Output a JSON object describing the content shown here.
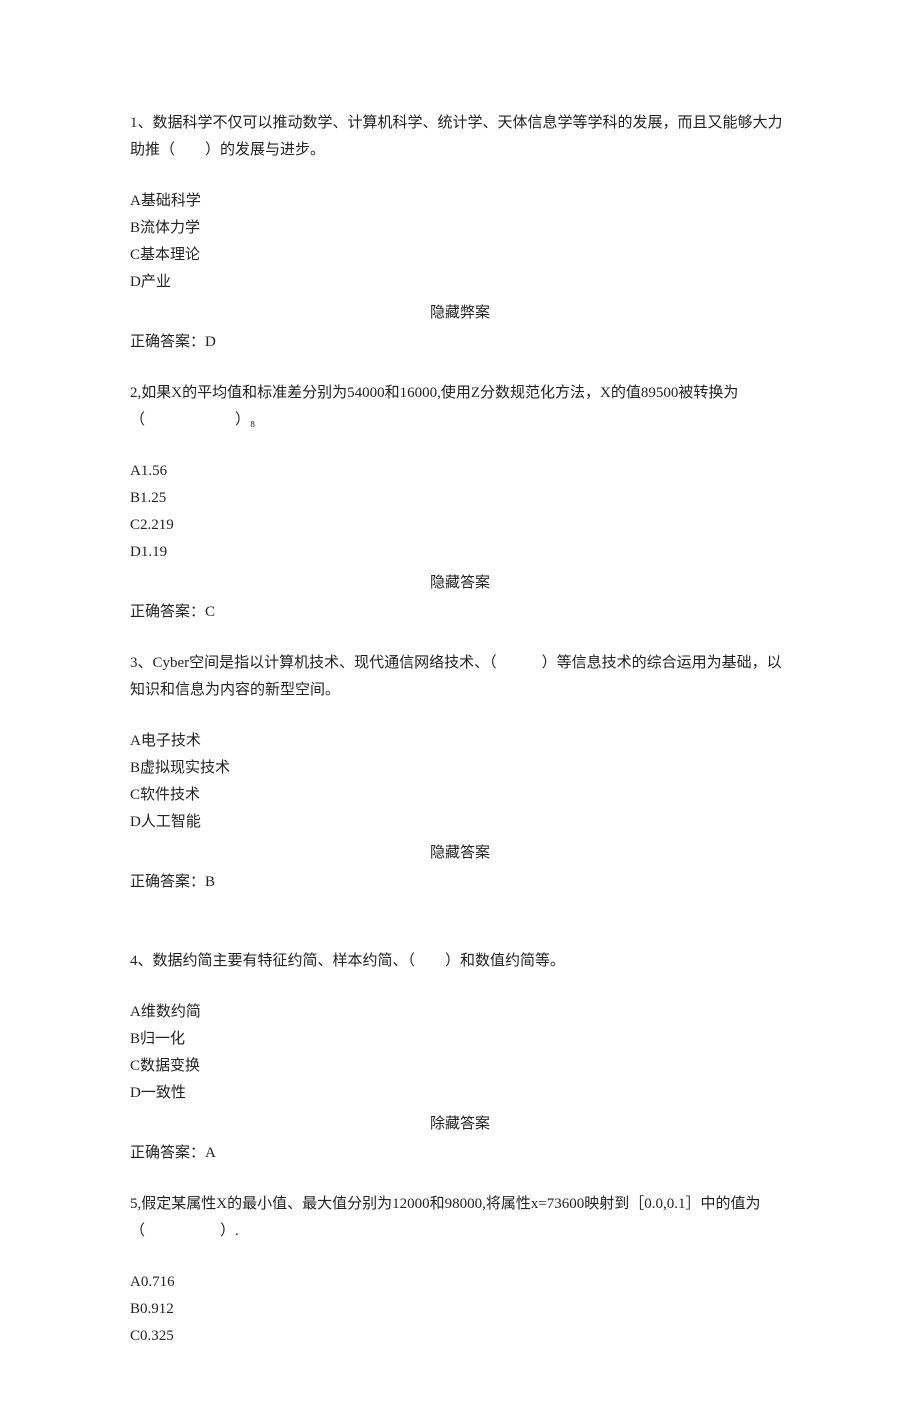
{
  "questions": [
    {
      "stem": "1、数据科学不仅可以推动数学、计算机科学、统计学、天体信息学等学科的发展，而且又能够大力助推（　　）的发展与进步。",
      "options": [
        "A基础科学",
        "B流体力学",
        "C基本理论",
        "D产业"
      ],
      "hide_answer_label": "隐藏弊案",
      "correct_label": "正确答案：D"
    },
    {
      "stem": "2,如果X的平均值和标准差分别为54000和16000,使用Z分数规范化方法，X的值89500被转换为（　　　　　　）₈",
      "options": [
        "A1.56",
        "B1.25",
        "C2.219",
        "D1.19"
      ],
      "hide_answer_label": "隐藏答案",
      "correct_label": "正确答案：C"
    },
    {
      "stem": "3、Cyber空间是指以计算机技术、现代通信网络技术、（　　　）等信息技术的综合运用为基础，以知识和信息为内容的新型空间。",
      "options": [
        "A电子技术",
        "B虚拟现实技术",
        "C软件技术",
        "D人工智能"
      ],
      "hide_answer_label": "隐藏答案",
      "correct_label": "正确答案：B"
    },
    {
      "stem": "4、数据约简主要有特征约简、样本约简、（　　）和数值约简等。",
      "options": [
        "A维数约简",
        "B归一化",
        "C数据变换",
        "D一致性"
      ],
      "hide_answer_label": "除藏答案",
      "correct_label": "正确答案：A"
    },
    {
      "stem": "5,假定某属性X的最小值、最大值分别为12000和98000,将属性x=73600映射到［0.0,0.1］中的值为（　　　　　）.",
      "options": [
        "A0.716",
        "B0.912",
        "C0.325"
      ],
      "hide_answer_label": "",
      "correct_label": ""
    }
  ]
}
